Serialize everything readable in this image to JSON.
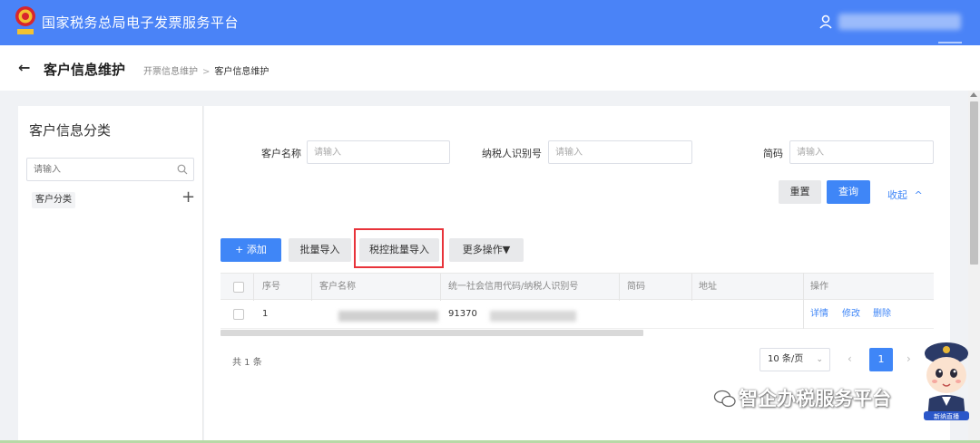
{
  "header": {
    "app_title": "国家税务总局电子发票服务平台",
    "emblem_icon": "tax-emblem-icon",
    "user_icon": "user-icon"
  },
  "subheader": {
    "back_icon": "back-arrow-icon",
    "title": "客户信息维护",
    "breadcrumb": [
      "开票信息维护",
      "客户信息维护"
    ],
    "breadcrumb_separator": ">"
  },
  "sidebar": {
    "title": "客户信息分类",
    "search_placeholder": "请输入",
    "category": "客户分类",
    "add_symbol": "+"
  },
  "filters": {
    "customer_name_label": "客户名称",
    "customer_name_placeholder": "请输入",
    "taxpayer_id_label": "纳税人识别号",
    "taxpayer_id_placeholder": "请输入",
    "short_code_label": "简码",
    "short_code_placeholder": "请输入",
    "reset_label": "重置",
    "query_label": "查询",
    "collapse_label": "收起",
    "collapse_icon": "^"
  },
  "toolbar": {
    "add_label": "+ 添加",
    "batch_import_label": "批量导入",
    "tax_control_import_label": "税控批量导入",
    "more_ops_label": "更多操作▼"
  },
  "table": {
    "columns": [
      "序号",
      "客户名称",
      "统一社会信用代码/纳税人识别号",
      "简码",
      "地址",
      "操作"
    ],
    "rows": [
      {
        "index": "1",
        "credit_code_visible": "91370",
        "actions": [
          "详情",
          "修改",
          "删除"
        ]
      }
    ]
  },
  "pagination": {
    "total_text": "共 1 条",
    "page_size": "10 条/页",
    "page_size_icon": "⌄",
    "prev_icon": "‹",
    "current_page": "1",
    "next_icon": "›"
  },
  "watermark": {
    "text": "智企办税服务平台",
    "mascot_badge": "新纳直播"
  },
  "colors": {
    "header_bg": "#4a83f7",
    "primary": "#3f86f7",
    "highlight_border": "#e8333a"
  }
}
